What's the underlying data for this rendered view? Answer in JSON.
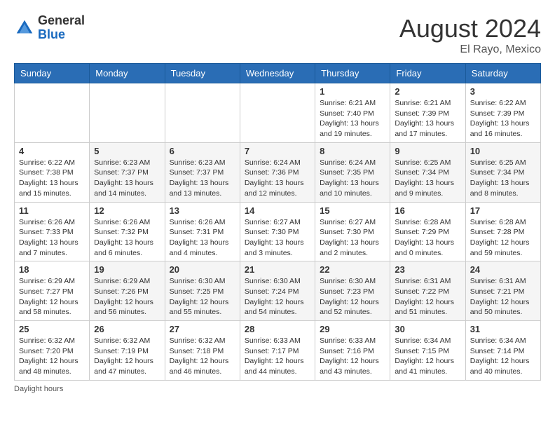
{
  "logo": {
    "text_general": "General",
    "text_blue": "Blue"
  },
  "title": {
    "month_year": "August 2024",
    "location": "El Rayo, Mexico"
  },
  "days_of_week": [
    "Sunday",
    "Monday",
    "Tuesday",
    "Wednesday",
    "Thursday",
    "Friday",
    "Saturday"
  ],
  "weeks": [
    [
      {
        "day": "",
        "info": ""
      },
      {
        "day": "",
        "info": ""
      },
      {
        "day": "",
        "info": ""
      },
      {
        "day": "",
        "info": ""
      },
      {
        "day": "1",
        "info": "Sunrise: 6:21 AM\nSunset: 7:40 PM\nDaylight: 13 hours and 19 minutes."
      },
      {
        "day": "2",
        "info": "Sunrise: 6:21 AM\nSunset: 7:39 PM\nDaylight: 13 hours and 17 minutes."
      },
      {
        "day": "3",
        "info": "Sunrise: 6:22 AM\nSunset: 7:39 PM\nDaylight: 13 hours and 16 minutes."
      }
    ],
    [
      {
        "day": "4",
        "info": "Sunrise: 6:22 AM\nSunset: 7:38 PM\nDaylight: 13 hours and 15 minutes."
      },
      {
        "day": "5",
        "info": "Sunrise: 6:23 AM\nSunset: 7:37 PM\nDaylight: 13 hours and 14 minutes."
      },
      {
        "day": "6",
        "info": "Sunrise: 6:23 AM\nSunset: 7:37 PM\nDaylight: 13 hours and 13 minutes."
      },
      {
        "day": "7",
        "info": "Sunrise: 6:24 AM\nSunset: 7:36 PM\nDaylight: 13 hours and 12 minutes."
      },
      {
        "day": "8",
        "info": "Sunrise: 6:24 AM\nSunset: 7:35 PM\nDaylight: 13 hours and 10 minutes."
      },
      {
        "day": "9",
        "info": "Sunrise: 6:25 AM\nSunset: 7:34 PM\nDaylight: 13 hours and 9 minutes."
      },
      {
        "day": "10",
        "info": "Sunrise: 6:25 AM\nSunset: 7:34 PM\nDaylight: 13 hours and 8 minutes."
      }
    ],
    [
      {
        "day": "11",
        "info": "Sunrise: 6:26 AM\nSunset: 7:33 PM\nDaylight: 13 hours and 7 minutes."
      },
      {
        "day": "12",
        "info": "Sunrise: 6:26 AM\nSunset: 7:32 PM\nDaylight: 13 hours and 6 minutes."
      },
      {
        "day": "13",
        "info": "Sunrise: 6:26 AM\nSunset: 7:31 PM\nDaylight: 13 hours and 4 minutes."
      },
      {
        "day": "14",
        "info": "Sunrise: 6:27 AM\nSunset: 7:30 PM\nDaylight: 13 hours and 3 minutes."
      },
      {
        "day": "15",
        "info": "Sunrise: 6:27 AM\nSunset: 7:30 PM\nDaylight: 13 hours and 2 minutes."
      },
      {
        "day": "16",
        "info": "Sunrise: 6:28 AM\nSunset: 7:29 PM\nDaylight: 13 hours and 0 minutes."
      },
      {
        "day": "17",
        "info": "Sunrise: 6:28 AM\nSunset: 7:28 PM\nDaylight: 12 hours and 59 minutes."
      }
    ],
    [
      {
        "day": "18",
        "info": "Sunrise: 6:29 AM\nSunset: 7:27 PM\nDaylight: 12 hours and 58 minutes."
      },
      {
        "day": "19",
        "info": "Sunrise: 6:29 AM\nSunset: 7:26 PM\nDaylight: 12 hours and 56 minutes."
      },
      {
        "day": "20",
        "info": "Sunrise: 6:30 AM\nSunset: 7:25 PM\nDaylight: 12 hours and 55 minutes."
      },
      {
        "day": "21",
        "info": "Sunrise: 6:30 AM\nSunset: 7:24 PM\nDaylight: 12 hours and 54 minutes."
      },
      {
        "day": "22",
        "info": "Sunrise: 6:30 AM\nSunset: 7:23 PM\nDaylight: 12 hours and 52 minutes."
      },
      {
        "day": "23",
        "info": "Sunrise: 6:31 AM\nSunset: 7:22 PM\nDaylight: 12 hours and 51 minutes."
      },
      {
        "day": "24",
        "info": "Sunrise: 6:31 AM\nSunset: 7:21 PM\nDaylight: 12 hours and 50 minutes."
      }
    ],
    [
      {
        "day": "25",
        "info": "Sunrise: 6:32 AM\nSunset: 7:20 PM\nDaylight: 12 hours and 48 minutes."
      },
      {
        "day": "26",
        "info": "Sunrise: 6:32 AM\nSunset: 7:19 PM\nDaylight: 12 hours and 47 minutes."
      },
      {
        "day": "27",
        "info": "Sunrise: 6:32 AM\nSunset: 7:18 PM\nDaylight: 12 hours and 46 minutes."
      },
      {
        "day": "28",
        "info": "Sunrise: 6:33 AM\nSunset: 7:17 PM\nDaylight: 12 hours and 44 minutes."
      },
      {
        "day": "29",
        "info": "Sunrise: 6:33 AM\nSunset: 7:16 PM\nDaylight: 12 hours and 43 minutes."
      },
      {
        "day": "30",
        "info": "Sunrise: 6:34 AM\nSunset: 7:15 PM\nDaylight: 12 hours and 41 minutes."
      },
      {
        "day": "31",
        "info": "Sunrise: 6:34 AM\nSunset: 7:14 PM\nDaylight: 12 hours and 40 minutes."
      }
    ]
  ],
  "footer": {
    "note": "Daylight hours"
  }
}
